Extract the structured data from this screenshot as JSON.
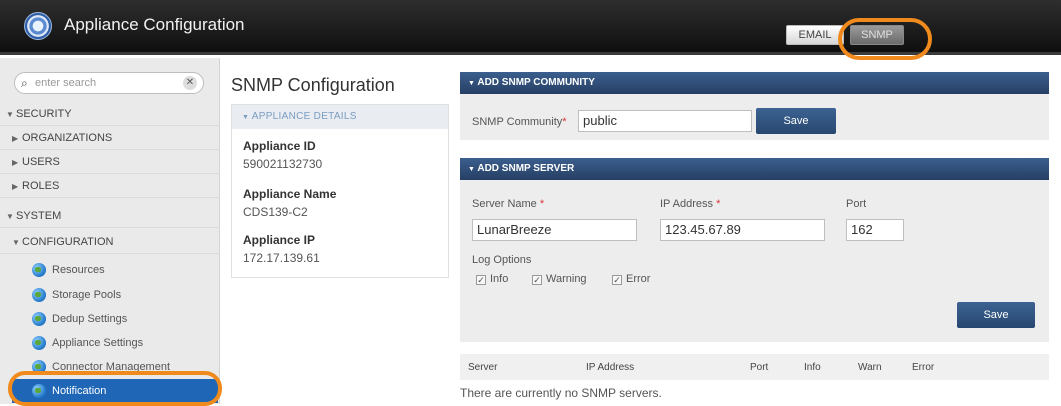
{
  "header": {
    "app_title": "Appliance Configuration",
    "tabs": [
      {
        "label": "EMAIL"
      },
      {
        "label": "SNMP"
      }
    ],
    "active_tab": "SNMP"
  },
  "sidebar": {
    "search_placeholder": "enter search",
    "items": [
      {
        "label": "SECURITY",
        "expanded": true
      },
      {
        "label": "ORGANIZATIONS"
      },
      {
        "label": "USERS"
      },
      {
        "label": "ROLES"
      },
      {
        "label": "SYSTEM",
        "expanded": true
      },
      {
        "label": "CONFIGURATION",
        "expanded": true
      },
      {
        "label": "Resources"
      },
      {
        "label": "Storage Pools"
      },
      {
        "label": "Dedup Settings"
      },
      {
        "label": "Appliance Settings"
      },
      {
        "label": "Connector Management"
      },
      {
        "label": "Notification",
        "selected": true
      }
    ]
  },
  "main": {
    "page_title": "SNMP Configuration",
    "appliance_details": {
      "header": "APPLIANCE DETAILS",
      "id_label": "Appliance ID",
      "id_value": "590021132730",
      "name_label": "Appliance Name",
      "name_value": "CDS139-C2",
      "ip_label": "Appliance IP",
      "ip_value": "172.17.139.61"
    },
    "add_community": {
      "header": "ADD SNMP COMMUNITY",
      "community_label": "SNMP Community",
      "community_value": "public",
      "save_label": "Save"
    },
    "add_server": {
      "header": "ADD SNMP SERVER",
      "server_name_label": "Server Name",
      "server_name_value": "LunarBreeze",
      "ip_label": "IP Address",
      "ip_value": "123.45.67.89",
      "port_label": "Port",
      "port_value": "162",
      "log_options_label": "Log Options",
      "log_options": [
        {
          "label": "Info",
          "checked": true
        },
        {
          "label": "Warning",
          "checked": true
        },
        {
          "label": "Error",
          "checked": true
        }
      ],
      "save_label": "Save"
    },
    "servers_table": {
      "columns": [
        "Server",
        "IP Address",
        "Port",
        "Info",
        "Warn",
        "Error"
      ],
      "empty_message": "There are currently no SNMP servers."
    }
  },
  "colors": {
    "accent": "#f08a1c",
    "panel_header": "#2f4f7a",
    "selected_nav": "#1f66b7"
  }
}
